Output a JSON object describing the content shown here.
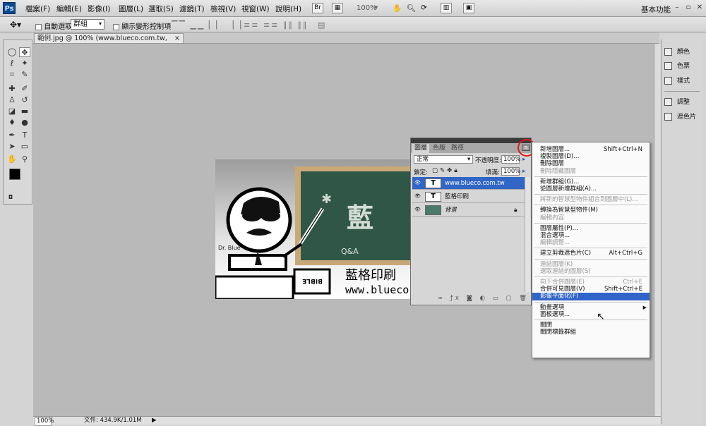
{
  "app": {
    "logo": "Ps"
  },
  "menubar": {
    "items": [
      "檔案(F)",
      "編輯(E)",
      "影像(I)",
      "圖層(L)",
      "選取(S)",
      "濾鏡(T)",
      "檢視(V)",
      "視窗(W)",
      "說明(H)"
    ],
    "zoom": "100%",
    "workspace": "基本功能"
  },
  "options": {
    "auto_select_label": "自動選取:",
    "auto_select_value": "群組",
    "show_transform_label": "顯示變形控制項"
  },
  "document": {
    "tab_title": "範例.jpg @ 100% (www.blueco.com.tw, RGB/8#) *",
    "image_text": {
      "board_main": "藍",
      "qa": "Q&A",
      "brand_cn": "藍格印刷",
      "brand_url": "www.blueco",
      "character": "Dr. Blue",
      "book": "BIBLE"
    }
  },
  "status": {
    "zoom": "100%",
    "doc_info": "文件: 434.9K/1.01M"
  },
  "dock": {
    "items": [
      {
        "label": "顏色",
        "icon": "color-icon"
      },
      {
        "label": "色票",
        "icon": "swatches-icon"
      },
      {
        "label": "樣式",
        "icon": "styles-icon"
      },
      {
        "label": "調整",
        "icon": "adjustments-icon"
      },
      {
        "label": "遮色片",
        "icon": "masks-icon"
      }
    ]
  },
  "layers_panel": {
    "tabs": [
      "圖層",
      "色版",
      "路徑"
    ],
    "blend_mode": "正常",
    "opacity_label": "不透明度:",
    "opacity_value": "100%",
    "lock_label": "鎖定:",
    "fill_label": "填滿:",
    "fill_value": "100%",
    "layers": [
      {
        "name": "www.blueco.com.tw",
        "thumb": "T",
        "selected": true
      },
      {
        "name": "藍格印刷",
        "thumb": "T",
        "selected": false
      },
      {
        "name": "背景",
        "thumb": "img",
        "selected": false
      }
    ]
  },
  "context_menu": {
    "items": [
      {
        "label": "新增圖層...",
        "shortcut": "Shift+Ctrl+N",
        "disabled": false
      },
      {
        "label": "複製圖層(D)...",
        "shortcut": "",
        "disabled": false
      },
      {
        "label": "刪除圖層",
        "shortcut": "",
        "disabled": false
      },
      {
        "label": "刪除隱藏圖層",
        "shortcut": "",
        "disabled": true
      },
      {
        "sep": true
      },
      {
        "label": "新增群組(G)...",
        "shortcut": "",
        "disabled": false
      },
      {
        "label": "從圖層新增群組(A)...",
        "shortcut": "",
        "disabled": false
      },
      {
        "sep": true
      },
      {
        "label": "將新的智慧型物件組合到圖層中(L)...",
        "shortcut": "",
        "disabled": true
      },
      {
        "sep": true
      },
      {
        "label": "轉換為智慧型物件(M)",
        "shortcut": "",
        "disabled": false
      },
      {
        "label": "編輯內容",
        "shortcut": "",
        "disabled": true
      },
      {
        "sep": true
      },
      {
        "label": "圖層屬性(P)...",
        "shortcut": "",
        "disabled": false
      },
      {
        "label": "混合選項...",
        "shortcut": "",
        "disabled": false
      },
      {
        "label": "編輯調整...",
        "shortcut": "",
        "disabled": true
      },
      {
        "sep": true
      },
      {
        "label": "建立剪裁遮色片(C)",
        "shortcut": "Alt+Ctrl+G",
        "disabled": false
      },
      {
        "sep": true
      },
      {
        "label": "連結圖層(K)",
        "shortcut": "",
        "disabled": true
      },
      {
        "label": "選取連結的圖層(S)",
        "shortcut": "",
        "disabled": true
      },
      {
        "sep": true
      },
      {
        "label": "向下合併圖層(E)",
        "shortcut": "Ctrl+E",
        "disabled": true
      },
      {
        "label": "合併可見圖層(V)",
        "shortcut": "Shift+Ctrl+E",
        "disabled": false
      },
      {
        "label": "影像平面化(F)",
        "shortcut": "",
        "disabled": false,
        "highlight": true
      },
      {
        "sep": true
      },
      {
        "label": "動畫選項",
        "shortcut": "",
        "disabled": false,
        "submenu": true
      },
      {
        "label": "面板選項...",
        "shortcut": "",
        "disabled": false
      },
      {
        "sep": true
      },
      {
        "label": "關閉",
        "shortcut": "",
        "disabled": false
      },
      {
        "label": "關閉標籤群組",
        "shortcut": "",
        "disabled": false
      }
    ]
  },
  "colors": {
    "accent": "#3164c8",
    "highlight_circle": "#e21b1b",
    "board": "#2f5647"
  }
}
